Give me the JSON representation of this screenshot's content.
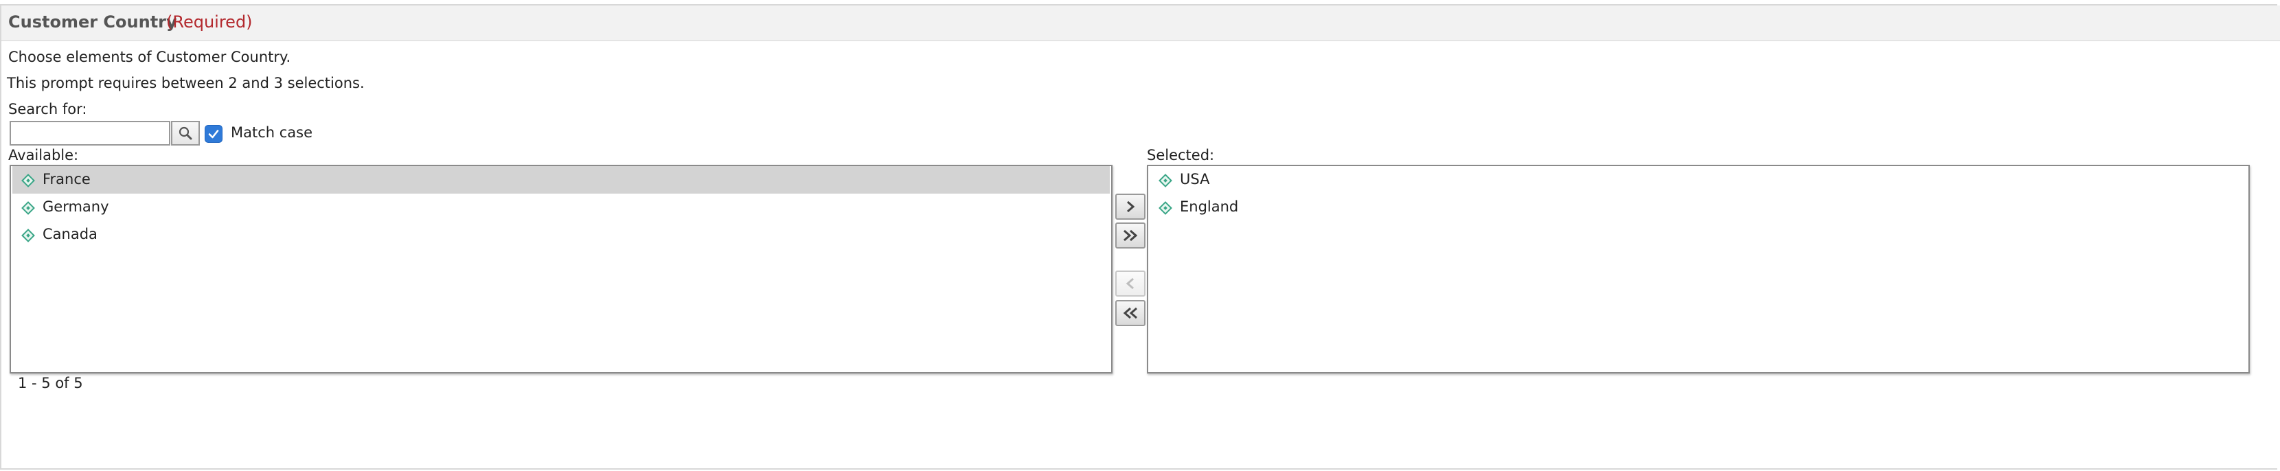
{
  "prompt": {
    "title": "Customer Country",
    "required_label": "(Required)",
    "instruction": "Choose elements of Customer Country.",
    "requirement": "This prompt requires between 2 and 3 selections."
  },
  "search": {
    "label": "Search for:",
    "value": "",
    "placeholder": "",
    "button_icon": "magnifier-icon",
    "match_case_label": "Match case",
    "match_case_checked": true
  },
  "available": {
    "label": "Available:",
    "items": [
      {
        "label": "France",
        "selected": true
      },
      {
        "label": "Germany",
        "selected": false
      },
      {
        "label": "Canada",
        "selected": false
      }
    ],
    "pager": "1 - 5 of 5"
  },
  "selected": {
    "label": "Selected:",
    "items": [
      {
        "label": "USA"
      },
      {
        "label": "England"
      }
    ]
  },
  "buttons": [
    {
      "icon": "chevron-right-icon",
      "enabled": true
    },
    {
      "icon": "double-chevron-right-icon",
      "enabled": true
    },
    {
      "icon": "chevron-left-icon",
      "enabled": false
    },
    {
      "icon": "double-chevron-left-icon",
      "enabled": true
    }
  ],
  "colors": {
    "required": "#b3282d",
    "selected_row": "#d3d3d3",
    "member_icon": "#3aa687",
    "checkbox": "#2f7ad8"
  }
}
